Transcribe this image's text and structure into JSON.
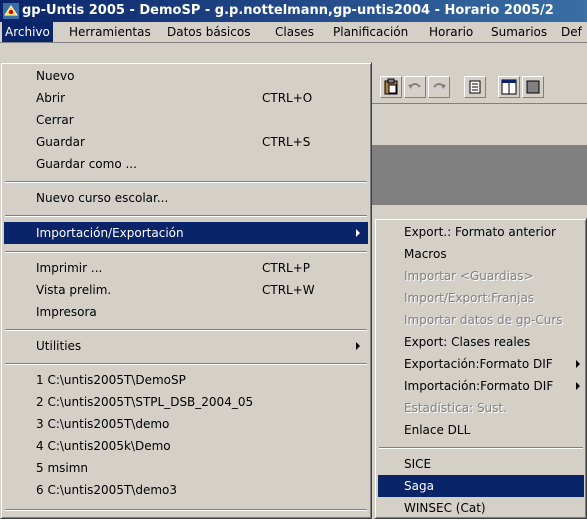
{
  "window": {
    "title": "gp-Untis 2005 - DemoSP  -  g.p.nottelmann,gp-untis2004  -  Horario 2005/2"
  },
  "menubar": {
    "items": [
      {
        "label": "Archivo",
        "active": true
      },
      {
        "label": "Herramientas"
      },
      {
        "label": "Datos básicos"
      },
      {
        "label": "Clases"
      },
      {
        "label": "Planificación"
      },
      {
        "label": "Horario"
      },
      {
        "label": "Sumarios"
      },
      {
        "label": "Def"
      }
    ]
  },
  "file_menu": {
    "items": [
      {
        "label": "Nuevo",
        "shortcut": ""
      },
      {
        "label": "Abrir",
        "shortcut": "CTRL+O"
      },
      {
        "label": "Cerrar",
        "shortcut": ""
      },
      {
        "label": "Guardar",
        "shortcut": "CTRL+S"
      },
      {
        "label": "Guardar como ...",
        "shortcut": ""
      },
      {
        "label": "Nuevo curso escolar...",
        "shortcut": ""
      },
      {
        "label": "Importación/Exportación",
        "shortcut": "",
        "submenu": true,
        "selected": true
      },
      {
        "label": "Imprimir ...",
        "shortcut": "CTRL+P"
      },
      {
        "label": "Vista prelim.",
        "shortcut": "CTRL+W"
      },
      {
        "label": "Impresora",
        "shortcut": ""
      },
      {
        "label": "Utilities",
        "shortcut": "",
        "submenu": true
      },
      {
        "label": "1 C:\\untis2005T\\DemoSP"
      },
      {
        "label": "2 C:\\untis2005T\\STPL_DSB_2004_05"
      },
      {
        "label": "3 C:\\untis2005T\\demo"
      },
      {
        "label": "4 C:\\untis2005k\\Demo"
      },
      {
        "label": "5 msimn"
      },
      {
        "label": "6 C:\\untis2005T\\demo3"
      }
    ]
  },
  "import_export_submenu": {
    "items": [
      {
        "label": "Export.: Formato anterior",
        "enabled": true
      },
      {
        "label": "Macros",
        "enabled": true
      },
      {
        "label": "Importar <Guardias>",
        "enabled": false
      },
      {
        "label": "Import/Export:Franjas",
        "enabled": false
      },
      {
        "label": "Importar datos de gp-Curs",
        "enabled": false
      },
      {
        "label": "Export: Clases reales",
        "enabled": true
      },
      {
        "label": "Exportación:Formato DIF",
        "enabled": true,
        "submenu": true
      },
      {
        "label": "Importación:Formato DIF",
        "enabled": true,
        "submenu": true
      },
      {
        "label": "Estadística: Sust.",
        "enabled": false
      },
      {
        "label": "Enlace DLL",
        "enabled": true
      },
      {
        "label": "SICE",
        "enabled": true
      },
      {
        "label": "Saga",
        "enabled": true,
        "selected": true
      },
      {
        "label": "WINSEC (Cat)",
        "enabled": true
      }
    ]
  },
  "colors": {
    "selection": "#0a246a",
    "face": "#d4d0c8",
    "disabled_text": "#808080"
  }
}
